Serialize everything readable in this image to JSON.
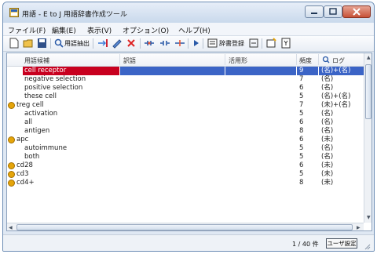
{
  "window": {
    "title": "用語 - E to J 用語辞書作成ツール"
  },
  "menu": [
    "ファイル(F)",
    "編集(E)",
    "表示(V)",
    "オプション(O)",
    "ヘルプ(H)"
  ],
  "toolbar": {
    "extract_label": "用語抽出",
    "dict_register_label": "辞書登録"
  },
  "table": {
    "columns": {
      "term": "用語候補",
      "translation": "訳語",
      "usage": "活用形",
      "freq": "頻度",
      "log": "ログ"
    },
    "rows": [
      {
        "term": "cell receptor",
        "freq": "9",
        "log": "(名)+(名)",
        "warn": false,
        "selected": true
      },
      {
        "term": "negative selection",
        "freq": "7",
        "log": "(名)",
        "warn": false,
        "selected": false
      },
      {
        "term": "positive selection",
        "freq": "6",
        "log": "(名)",
        "warn": false,
        "selected": false
      },
      {
        "term": "these cell",
        "freq": "5",
        "log": "(名)+(名)",
        "warn": false,
        "selected": false
      },
      {
        "term": "treg cell",
        "freq": "7",
        "log": "(未)+(名)",
        "warn": true,
        "selected": false
      },
      {
        "term": "activation",
        "freq": "5",
        "log": "(名)",
        "warn": false,
        "selected": false
      },
      {
        "term": "all",
        "freq": "6",
        "log": "(名)",
        "warn": false,
        "selected": false
      },
      {
        "term": "antigen",
        "freq": "8",
        "log": "(名)",
        "warn": false,
        "selected": false
      },
      {
        "term": "apc",
        "freq": "6",
        "log": "(未)",
        "warn": true,
        "selected": false
      },
      {
        "term": "autoimmune",
        "freq": "5",
        "log": "(名)",
        "warn": false,
        "selected": false
      },
      {
        "term": "both",
        "freq": "5",
        "log": "(名)",
        "warn": false,
        "selected": false
      },
      {
        "term": "cd28",
        "freq": "6",
        "log": "(未)",
        "warn": true,
        "selected": false
      },
      {
        "term": "cd3",
        "freq": "5",
        "log": "(未)",
        "warn": true,
        "selected": false
      },
      {
        "term": "cd4+",
        "freq": "8",
        "log": "(未)",
        "warn": true,
        "selected": false
      }
    ]
  },
  "status": {
    "page": "1 / 40 件",
    "user_setting_label": "ユーザ設定"
  }
}
